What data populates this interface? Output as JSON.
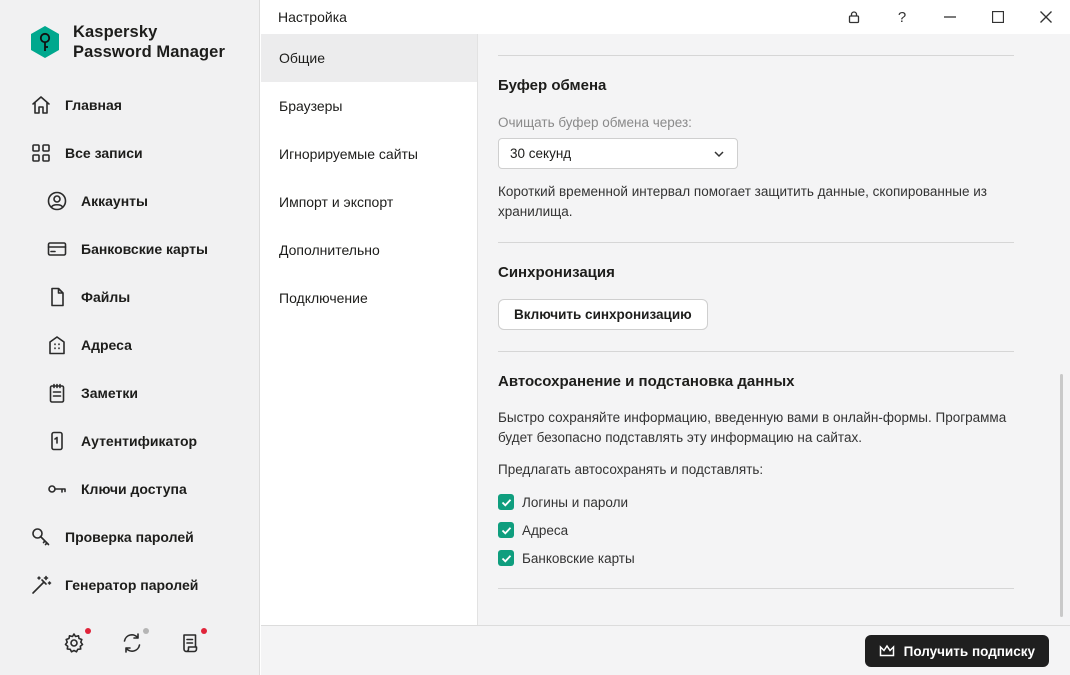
{
  "app": {
    "name_line1": "Kaspersky",
    "name_line2": "Password Manager",
    "brand_color": "#00a88e"
  },
  "sidebar": {
    "items": [
      {
        "label": "Главная",
        "icon": "home-icon",
        "level": "top"
      },
      {
        "label": "Все записи",
        "icon": "grid-icon",
        "level": "top"
      },
      {
        "label": "Аккаунты",
        "icon": "user-circle-icon",
        "level": "sub"
      },
      {
        "label": "Банковские карты",
        "icon": "credit-card-icon",
        "level": "sub"
      },
      {
        "label": "Файлы",
        "icon": "file-icon",
        "level": "sub"
      },
      {
        "label": "Адреса",
        "icon": "building-icon",
        "level": "sub"
      },
      {
        "label": "Заметки",
        "icon": "notepad-icon",
        "level": "sub"
      },
      {
        "label": "Аутентификатор",
        "icon": "phone-icon",
        "level": "sub"
      },
      {
        "label": "Ключи доступа",
        "icon": "key-icon",
        "level": "sub"
      },
      {
        "label": "Проверка паролей",
        "icon": "password-check-icon",
        "level": "top"
      },
      {
        "label": "Генератор паролей",
        "icon": "magic-wand-icon",
        "level": "top"
      }
    ],
    "bottom_icons": [
      {
        "icon": "gear-icon",
        "dot_color": "#e0243a"
      },
      {
        "icon": "sync-icon",
        "dot_color": "#b5b5b5"
      },
      {
        "icon": "notes-icon",
        "dot_color": "#e0243a"
      }
    ]
  },
  "window": {
    "title": "Настройка",
    "help_glyph": "?"
  },
  "settings_nav": {
    "items": [
      "Общие",
      "Браузеры",
      "Игнорируемые сайты",
      "Импорт и экспорт",
      "Дополнительно",
      "Подключение"
    ],
    "active": "Общие"
  },
  "clipboard": {
    "title": "Буфер обмена",
    "select_label": "Очищать буфер обмена через:",
    "select_value": "30 секунд",
    "description": "Короткий временной интервал помогает защитить данные, скопированные из хранилища."
  },
  "sync": {
    "title": "Синхронизация",
    "button_label": "Включить синхронизацию"
  },
  "autosave": {
    "title": "Автосохранение и подстановка данных",
    "description": "Быстро сохраняйте информацию, введенную вами в онлайн-формы. Программа будет безопасно подставлять эту информацию на сайтах.",
    "prompt": "Предлагать автосохранять и подставлять:",
    "options": [
      {
        "label": "Логины и пароли",
        "checked": true
      },
      {
        "label": "Адреса",
        "checked": true
      },
      {
        "label": "Банковские карты",
        "checked": true
      }
    ],
    "check_color": "#0f9e7e"
  },
  "footer": {
    "subscribe_label": "Получить подписку"
  }
}
